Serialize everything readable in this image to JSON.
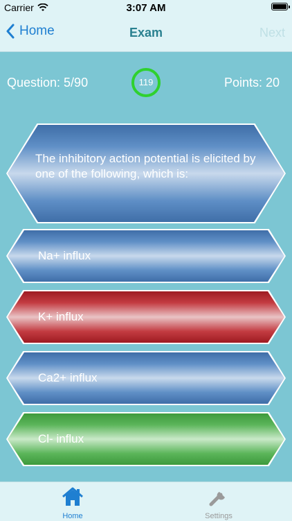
{
  "status": {
    "carrier": "Carrier",
    "time": "3:07 AM"
  },
  "nav": {
    "back_label": "Home",
    "title": "Exam",
    "next_label": "Next"
  },
  "info": {
    "question_counter": "Question: 5/90",
    "timer_value": "119",
    "points": "Points: 20"
  },
  "question": {
    "text": "The inhibitory action potential is elicited by one of the following, which is:"
  },
  "answers": [
    {
      "label": "Na+ influx",
      "state": "default"
    },
    {
      "label": "K+ influx",
      "state": "wrong"
    },
    {
      "label": "Ca2+ influx",
      "state": "default"
    },
    {
      "label": "Cl- influx",
      "state": "correct"
    }
  ],
  "tabs": [
    {
      "label": "Home",
      "icon": "home-icon",
      "active": true
    },
    {
      "label": "Settings",
      "icon": "wrench-icon",
      "active": false
    }
  ],
  "colors": {
    "background": "#7cc6d3",
    "accent": "#1f7fd1",
    "timer_ring": "#2fd12f",
    "wrong": "#c33b41",
    "correct": "#5bb55a"
  }
}
